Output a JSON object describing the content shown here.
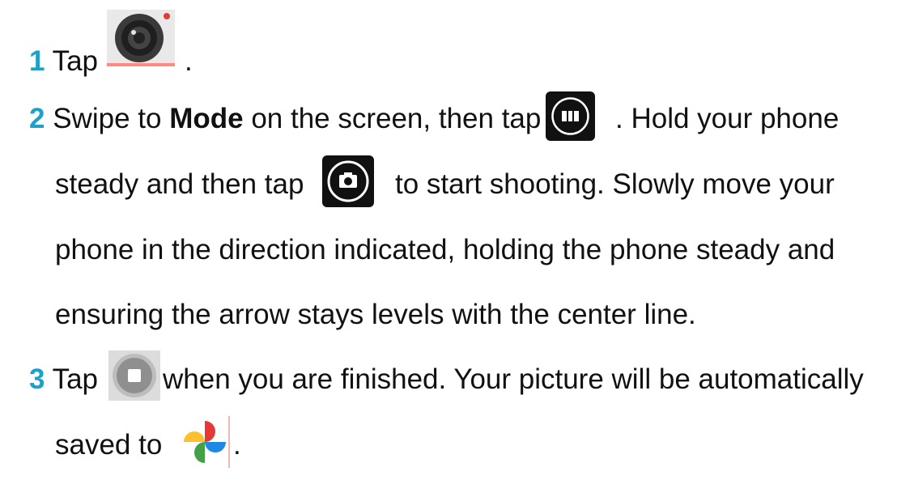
{
  "colors": {
    "step_number": "#1da1c8",
    "text": "#111111"
  },
  "step1": {
    "number": "1",
    "text_before": "Tap",
    "icon": "camera-app-icon",
    "text_after": "."
  },
  "step2": {
    "number": "2",
    "line1_before": "Swipe to",
    "line1_bold": "Mode",
    "line1_mid": "on the screen, then tap",
    "icon_panorama": "panorama-mode-icon",
    "line1_after": ". Hold your phone",
    "line2_before": "steady and then tap",
    "icon_shutter": "shutter-camera-icon",
    "line2_after": "to start shooting. Slowly move your",
    "line3": "phone in the direction indicated, holding the phone steady and",
    "line4": "ensuring the arrow stays levels with the center line."
  },
  "step3": {
    "number": "3",
    "line1_before": "Tap",
    "icon_stop": "stop-recording-icon",
    "line1_after": "when you are finished. Your picture will be automatically",
    "line2_before": "saved to",
    "icon_photos": "google-photos-icon",
    "line2_after": "."
  }
}
